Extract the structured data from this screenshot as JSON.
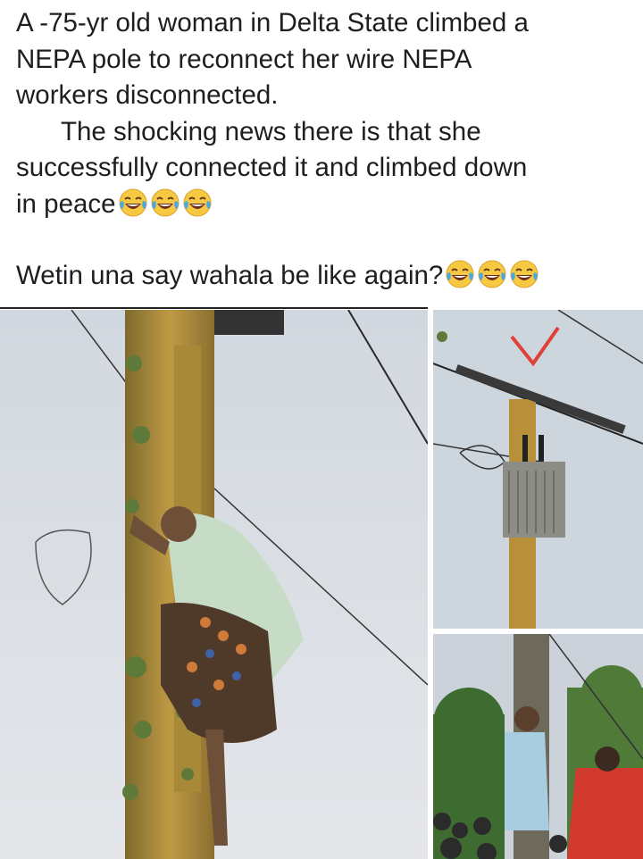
{
  "post": {
    "line1": "A -75-yr old woman in Delta State climbed a",
    "line2": "NEPA pole to reconnect her wire NEPA",
    "line3": "workers disconnected.",
    "line4": "The shocking news there is that she",
    "line5": "successfully connected it and climbed down",
    "line6": "in peace",
    "line7": "Wetin una say wahala be like again?",
    "emoji_icon": "crying-laughing-face-icon",
    "emoji_count_line6": 3,
    "emoji_count_line7": 3
  },
  "photos": [
    {
      "id": "main",
      "icon": "woman-climbing-pole-photo"
    },
    {
      "id": "top-right",
      "icon": "pole-transformer-photo"
    },
    {
      "id": "bottom-right",
      "icon": "woman-on-pole-crowd-photo"
    }
  ],
  "colors": {
    "text": "#1c1e21",
    "sky": "#d9dde3",
    "pole": "#b8903a",
    "check_mark": "#e0403a"
  }
}
